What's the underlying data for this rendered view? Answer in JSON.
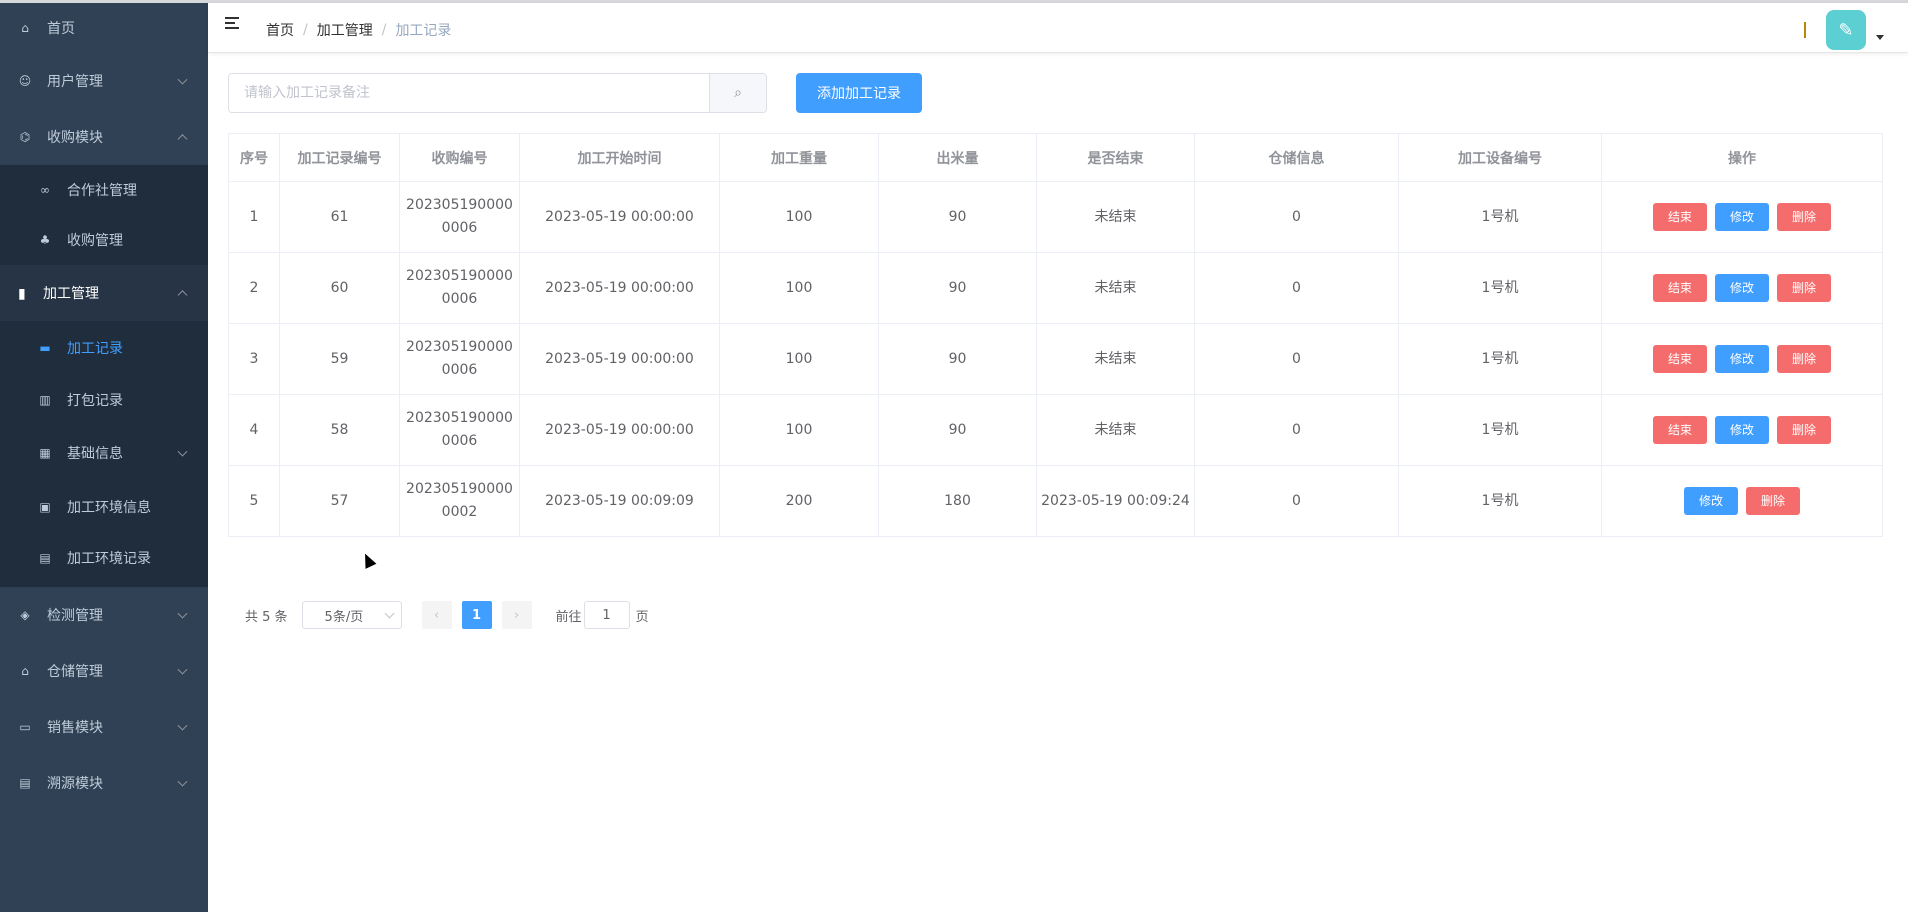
{
  "sidebar": {
    "items": [
      {
        "label": "首页",
        "icon": "home-icon"
      },
      {
        "label": "用户管理",
        "icon": "user-icon"
      },
      {
        "label": "收购模块",
        "icon": "bank-icon"
      },
      {
        "label": "合作社管理",
        "icon": "link-icon"
      },
      {
        "label": "收购管理",
        "icon": "tree-icon"
      },
      {
        "label": "加工管理",
        "icon": "book-icon"
      },
      {
        "label": "加工记录",
        "icon": "message-icon"
      },
      {
        "label": "打包记录",
        "icon": "chart-icon"
      },
      {
        "label": "基础信息",
        "icon": "grid-icon"
      },
      {
        "label": "加工环境信息",
        "icon": "clipboard-icon"
      },
      {
        "label": "加工环境记录",
        "icon": "document-icon"
      },
      {
        "label": "检测管理",
        "icon": "shield-icon"
      },
      {
        "label": "仓储管理",
        "icon": "warehouse-icon"
      },
      {
        "label": "销售模块",
        "icon": "bag-icon"
      },
      {
        "label": "溯源模块",
        "icon": "trace-icon"
      }
    ]
  },
  "breadcrumb": [
    "首页",
    "加工管理",
    "加工记录"
  ],
  "search": {
    "placeholder": "请输入加工记录备注"
  },
  "toolbar": {
    "add_label": "添加加工记录"
  },
  "table": {
    "columns": [
      "序号",
      "加工记录编号",
      "收购编号",
      "加工开始时间",
      "加工重量",
      "出米量",
      "是否结束",
      "仓储信息",
      "加工设备编号",
      "操作"
    ],
    "rows": [
      {
        "idx": "1",
        "id": "61",
        "purchase_a": "202305190000",
        "purchase_b": "0006",
        "start": "2023-05-19 00:00:00",
        "weight": "100",
        "output": "90",
        "ended": "未结束",
        "storage": "0",
        "device": "1号机"
      },
      {
        "idx": "2",
        "id": "60",
        "purchase_a": "202305190000",
        "purchase_b": "0006",
        "start": "2023-05-19 00:00:00",
        "weight": "100",
        "output": "90",
        "ended": "未结束",
        "storage": "0",
        "device": "1号机"
      },
      {
        "idx": "3",
        "id": "59",
        "purchase_a": "202305190000",
        "purchase_b": "0006",
        "start": "2023-05-19 00:00:00",
        "weight": "100",
        "output": "90",
        "ended": "未结束",
        "storage": "0",
        "device": "1号机"
      },
      {
        "idx": "4",
        "id": "58",
        "purchase_a": "202305190000",
        "purchase_b": "0006",
        "start": "2023-05-19 00:00:00",
        "weight": "100",
        "output": "90",
        "ended": "未结束",
        "storage": "0",
        "device": "1号机"
      },
      {
        "idx": "5",
        "id": "57",
        "purchase_a": "202305190000",
        "purchase_b": "0002",
        "start": "2023-05-19 00:09:09",
        "weight": "200",
        "output": "180",
        "ended": "2023-05-19 00:09:24",
        "storage": "0",
        "device": "1号机"
      }
    ],
    "actions": {
      "end": "结束",
      "edit": "修改",
      "delete": "删除"
    }
  },
  "pagination": {
    "total": "共 5 条",
    "page_size": "5条/页",
    "current": "1",
    "goto_prefix": "前往",
    "goto_value": "1",
    "goto_suffix": "页"
  },
  "colors": {
    "sidebar": "#304156",
    "accent": "#409eff",
    "danger": "#f56c6c"
  }
}
